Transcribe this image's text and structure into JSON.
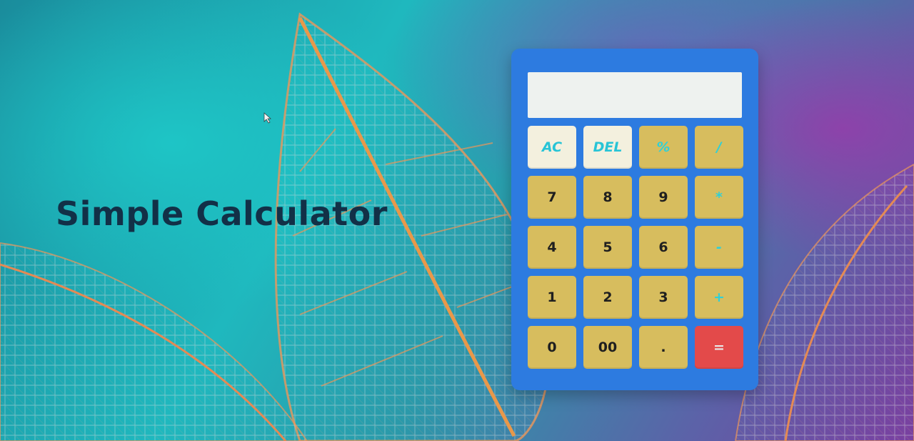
{
  "page": {
    "title": "Simple Calculator"
  },
  "calculator": {
    "display_value": "",
    "rows": [
      [
        {
          "label": "AC",
          "style": "light",
          "name": "all-clear-button"
        },
        {
          "label": "DEL",
          "style": "light",
          "name": "delete-button"
        },
        {
          "label": "%",
          "style": "op",
          "name": "percent-button"
        },
        {
          "label": "/",
          "style": "op",
          "name": "divide-button"
        }
      ],
      [
        {
          "label": "7",
          "style": "num",
          "name": "key-7-button"
        },
        {
          "label": "8",
          "style": "num",
          "name": "key-8-button"
        },
        {
          "label": "9",
          "style": "num",
          "name": "key-9-button"
        },
        {
          "label": "*",
          "style": "op",
          "name": "multiply-button"
        }
      ],
      [
        {
          "label": "4",
          "style": "num",
          "name": "key-4-button"
        },
        {
          "label": "5",
          "style": "num",
          "name": "key-5-button"
        },
        {
          "label": "6",
          "style": "num",
          "name": "key-6-button"
        },
        {
          "label": "-",
          "style": "op",
          "name": "subtract-button"
        }
      ],
      [
        {
          "label": "1",
          "style": "num",
          "name": "key-1-button"
        },
        {
          "label": "2",
          "style": "num",
          "name": "key-2-button"
        },
        {
          "label": "3",
          "style": "num",
          "name": "key-3-button"
        },
        {
          "label": "+",
          "style": "op",
          "name": "add-button"
        }
      ],
      [
        {
          "label": "0",
          "style": "num",
          "name": "key-0-button"
        },
        {
          "label": "00",
          "style": "num",
          "name": "key-00-button"
        },
        {
          "label": ".",
          "style": "num",
          "name": "decimal-button"
        },
        {
          "label": "=",
          "style": "eq",
          "name": "equals-button"
        }
      ]
    ]
  },
  "colors": {
    "calculator_body": "#2d7be0",
    "key": "#d7bd5e",
    "key_light": "#f3f0de",
    "operator_text": "#2fd0d8",
    "equals": "#e34a4a",
    "title": "#123047"
  }
}
